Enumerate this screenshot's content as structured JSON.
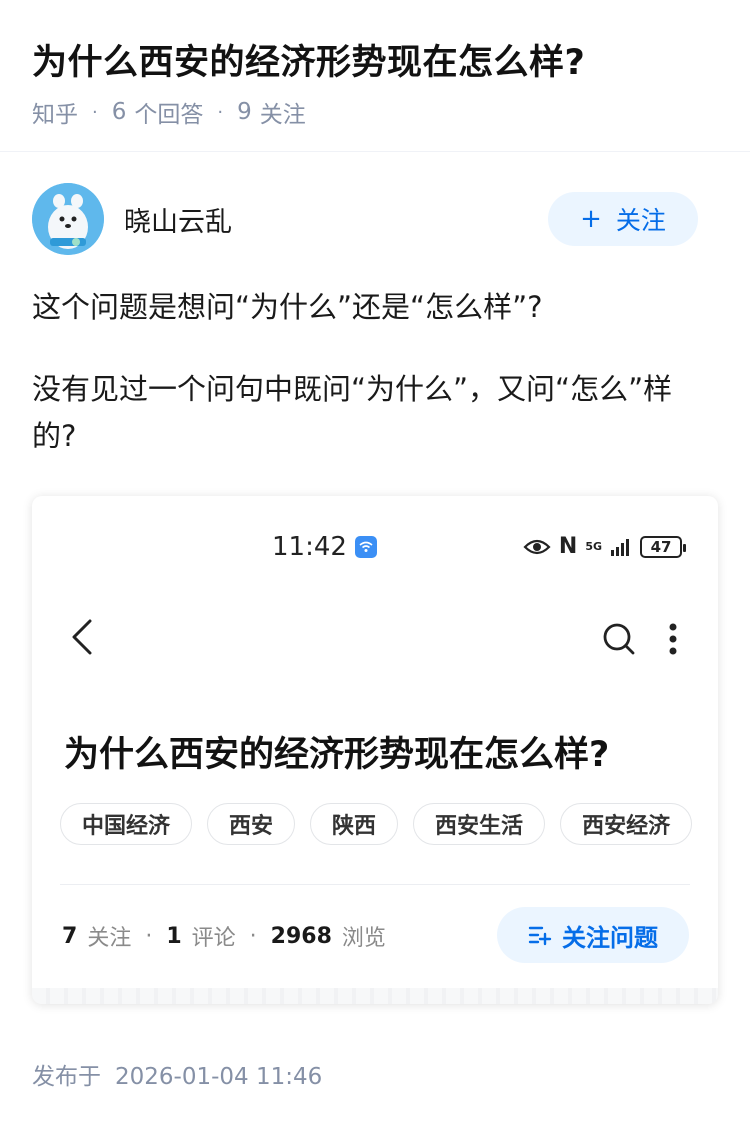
{
  "question": {
    "title": "为什么西安的经济形势现在怎么样?",
    "source": "知乎",
    "answer_count": "6",
    "answer_label": "个回答",
    "follow_count": "9",
    "follow_label": "关注"
  },
  "author": {
    "name": "晓山云乱",
    "follow_label": "关注",
    "follow_icon": "+"
  },
  "content": {
    "paragraph1": "这个问题是想问“为什么”还是“怎么样”?",
    "paragraph2": "没有见过一个问句中既问“为什么”，又问“怎么”样的?"
  },
  "screenshot_card": {
    "status_time": "11:42",
    "battery": "47",
    "network": "5G",
    "title": "为什么西安的经济形势现在怎么样?",
    "tags": [
      "中国经济",
      "西安",
      "陕西",
      "西安生活",
      "西安经济"
    ],
    "stats": {
      "follow_value": "7",
      "follow_label": "关注",
      "comment_value": "1",
      "comment_label": "评论",
      "view_value": "2968",
      "view_label": "浏览"
    },
    "follow_question_label": "关注问题"
  },
  "footer": {
    "publish_label": "发布于",
    "publish_time": "2026-01-04 11:46"
  },
  "colors": {
    "accent": "#056de8",
    "accent_bg": "#ebf5ff",
    "meta_gray": "#8590a6"
  }
}
